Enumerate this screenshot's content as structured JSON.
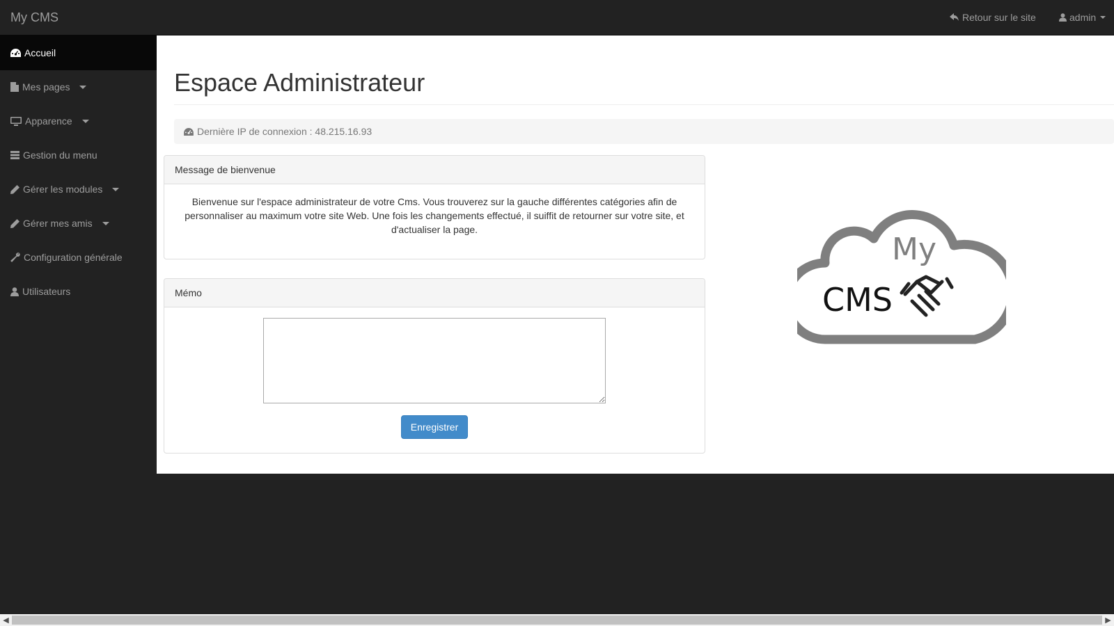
{
  "navbar": {
    "brand": "My CMS",
    "back_link": "Retour sur le site",
    "user_menu": "admin"
  },
  "sidebar": {
    "items": [
      {
        "label": "Accueil",
        "icon": "dashboard-icon",
        "active": true,
        "dropdown": false
      },
      {
        "label": "Mes pages",
        "icon": "file-icon",
        "active": false,
        "dropdown": true
      },
      {
        "label": "Apparence",
        "icon": "monitor-icon",
        "active": false,
        "dropdown": true
      },
      {
        "label": "Gestion du menu",
        "icon": "list-icon",
        "active": false,
        "dropdown": false
      },
      {
        "label": "Gérer les modules",
        "icon": "pencil-icon",
        "active": false,
        "dropdown": true
      },
      {
        "label": "Gérer mes amis",
        "icon": "pencil-icon",
        "active": false,
        "dropdown": true
      },
      {
        "label": "Configuration générale",
        "icon": "wrench-icon",
        "active": false,
        "dropdown": false
      },
      {
        "label": "Utilisateurs",
        "icon": "user-icon",
        "active": false,
        "dropdown": false
      }
    ]
  },
  "main": {
    "title": "Espace Administrateur",
    "last_ip": "Dernière IP de connexion : 48.215.16.93",
    "welcome_panel": {
      "heading": "Message de bienvenue",
      "body": "Bienvenue sur l'espace administrateur de votre Cms. Vous trouverez sur la gauche différentes catégories afin de personnaliser au maximum votre site Web. Une fois les changements effectué, il suiffit de retourner sur votre site, et d'actualiser la page."
    },
    "memo_panel": {
      "heading": "Mémo",
      "textarea_value": "",
      "save_label": "Enregistrer"
    },
    "logo": {
      "line1": "My",
      "line2": "CMS"
    }
  },
  "colors": {
    "navbar_bg": "#222222",
    "accent": "#428bca",
    "logo_gray": "#7f7f7f"
  }
}
